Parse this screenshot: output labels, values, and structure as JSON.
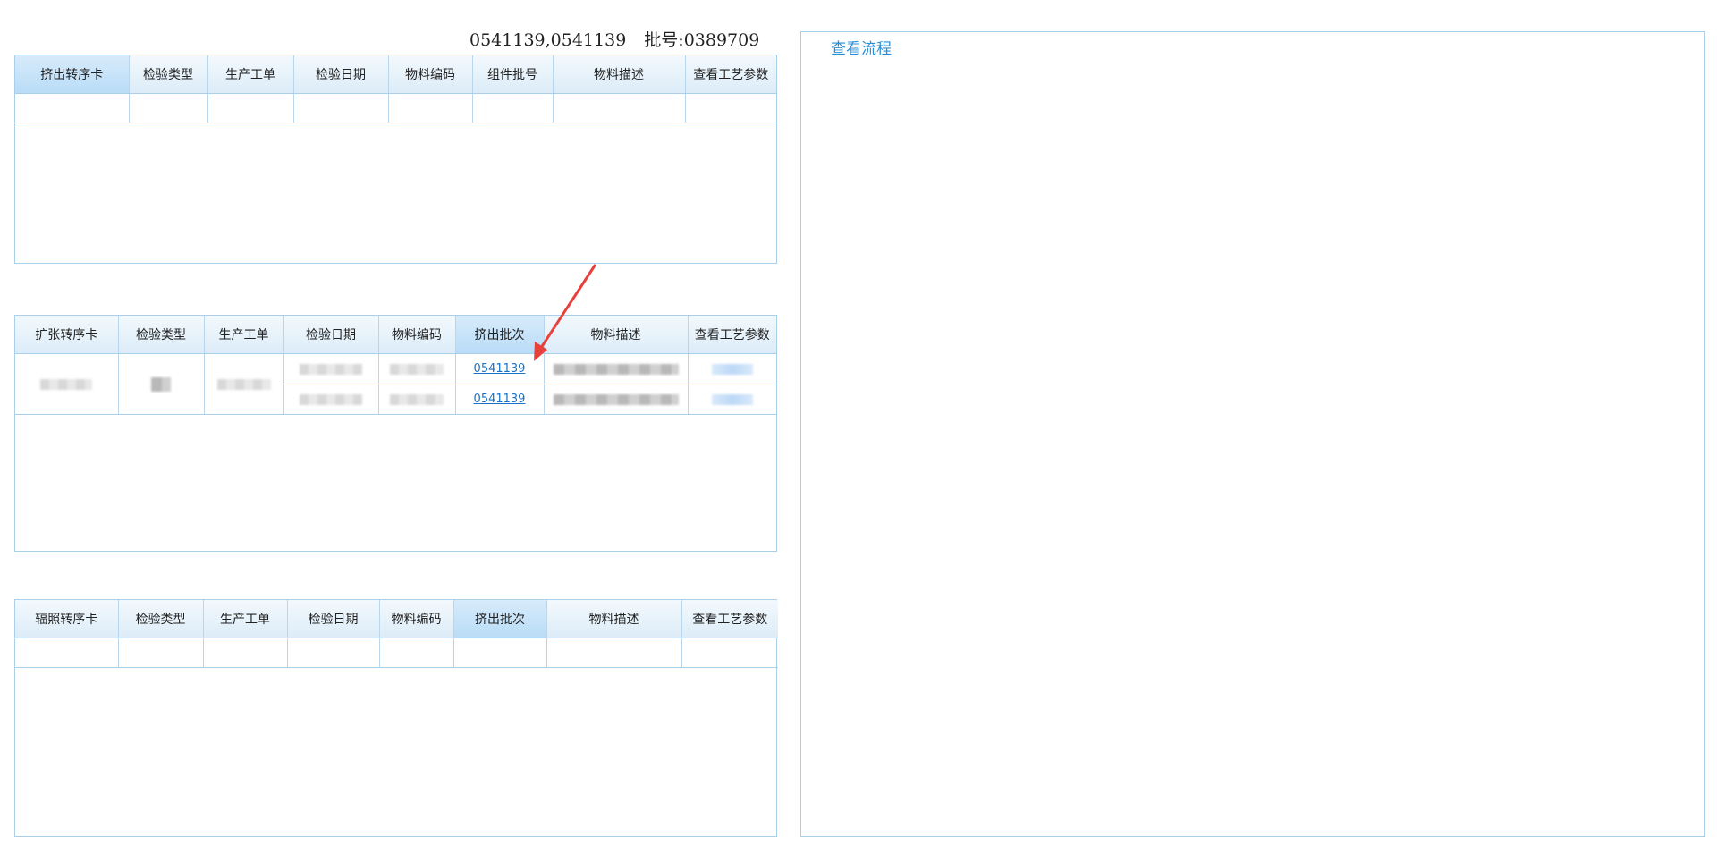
{
  "header": {
    "batch_values": "0541139,0541139",
    "batch_label": "批号:",
    "batch_number": "0389709"
  },
  "extrusion_table": {
    "columns": [
      "挤出转序卡",
      "检验类型",
      "生产工单",
      "检验日期",
      "物料编码",
      "组件批号",
      "物料描述",
      "查看工艺参数"
    ]
  },
  "expansion_table": {
    "columns": [
      "扩张转序卡",
      "检验类型",
      "生产工单",
      "检验日期",
      "物料编码",
      "挤出批次",
      "物料描述",
      "查看工艺参数"
    ],
    "rows": [
      {
        "extrusion_batch": "0541139"
      },
      {
        "extrusion_batch": "0541139"
      }
    ]
  },
  "irradiation_table": {
    "columns": [
      "辐照转序卡",
      "检验类型",
      "生产工单",
      "检验日期",
      "物料编码",
      "挤出批次",
      "物料描述",
      "查看工艺参数"
    ]
  },
  "flow_panel": {
    "link_label": "查看流程"
  },
  "colors": {
    "annotation_arrow": "#e8403a",
    "link": "#1a73c8",
    "border": "#a9cfea"
  }
}
